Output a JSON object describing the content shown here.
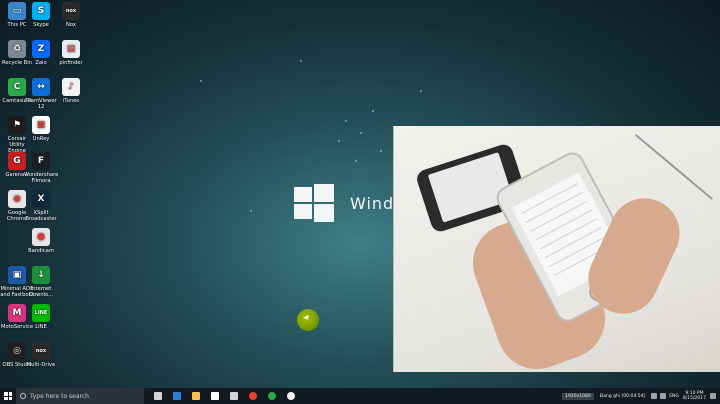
{
  "desktop": {
    "icons": [
      {
        "label": "This PC",
        "color": "#3a86c8",
        "glyph": "▭"
      },
      {
        "label": "Skype",
        "color": "#00aff0",
        "glyph": "S"
      },
      {
        "label": "Nox",
        "color": "#2b2b2b",
        "glyph": "nox"
      },
      {
        "label": "Recycle Bin",
        "color": "#7d8a93",
        "glyph": "♻"
      },
      {
        "label": "Zalo",
        "color": "#0a68ff",
        "glyph": "Z"
      },
      {
        "label": "pinfinder",
        "color": "#e9eef2",
        "glyph": "▤"
      },
      {
        "label": "Camtasia 9",
        "color": "#2aa84a",
        "glyph": "C"
      },
      {
        "label": "TeamViewer 12",
        "color": "#0e6ed8",
        "glyph": "↔"
      },
      {
        "label": "iTunes",
        "color": "#f3f3f5",
        "glyph": "♪"
      },
      {
        "label": "Corsair Utility Engine",
        "color": "#1c1c1c",
        "glyph": "⚑"
      },
      {
        "label": "UnRey",
        "color": "#ffffff",
        "glyph": "▦"
      },
      {
        "label": "Garena+",
        "color": "#c81e1e",
        "glyph": "G"
      },
      {
        "label": "Wondershare Filmora",
        "color": "#1b1f24",
        "glyph": "F"
      },
      {
        "label": "Google Chrome",
        "color": "#e8e8e8",
        "glyph": "◉"
      },
      {
        "label": "XSplit Broadcaster",
        "color": "#0e2a3a",
        "glyph": "X"
      },
      {
        "label": "Bandicam",
        "color": "#e7e7e7",
        "glyph": "●"
      },
      {
        "label": "Minimal ADB and Fastboot",
        "color": "#1e5aa8",
        "glyph": "▣"
      },
      {
        "label": "Internet Downlo...",
        "color": "#1c8f3a",
        "glyph": "↓"
      },
      {
        "label": "MotoService",
        "color": "#d8347f",
        "glyph": "M"
      },
      {
        "label": "LINE",
        "color": "#00b900",
        "glyph": "LINE"
      },
      {
        "label": "OBS Studio",
        "color": "#1f1f1f",
        "glyph": "◎"
      },
      {
        "label": "Multi-Drive",
        "color": "#2b2b2b",
        "glyph": "nox"
      }
    ]
  },
  "windows_brand": {
    "text": "Windo"
  },
  "taskbar": {
    "search_placeholder": "Type here to search",
    "apps": [
      {
        "name": "task-view",
        "color": "#d0d4d6"
      },
      {
        "name": "edge",
        "color": "#2f7cd6"
      },
      {
        "name": "file-explorer",
        "color": "#f2c14e"
      },
      {
        "name": "store",
        "color": "#ffffff"
      },
      {
        "name": "mail",
        "color": "#d0d4d6"
      },
      {
        "name": "chrome",
        "color": "#e94235"
      },
      {
        "name": "camtasia",
        "color": "#2aa84a"
      },
      {
        "name": "itunes",
        "color": "#f3f3f5"
      }
    ],
    "resolution": "1920x1080",
    "recording": "Đang ghi [00:04:54]",
    "language": "ENG",
    "time": "9:10 PM",
    "date": "8/15/2017"
  }
}
